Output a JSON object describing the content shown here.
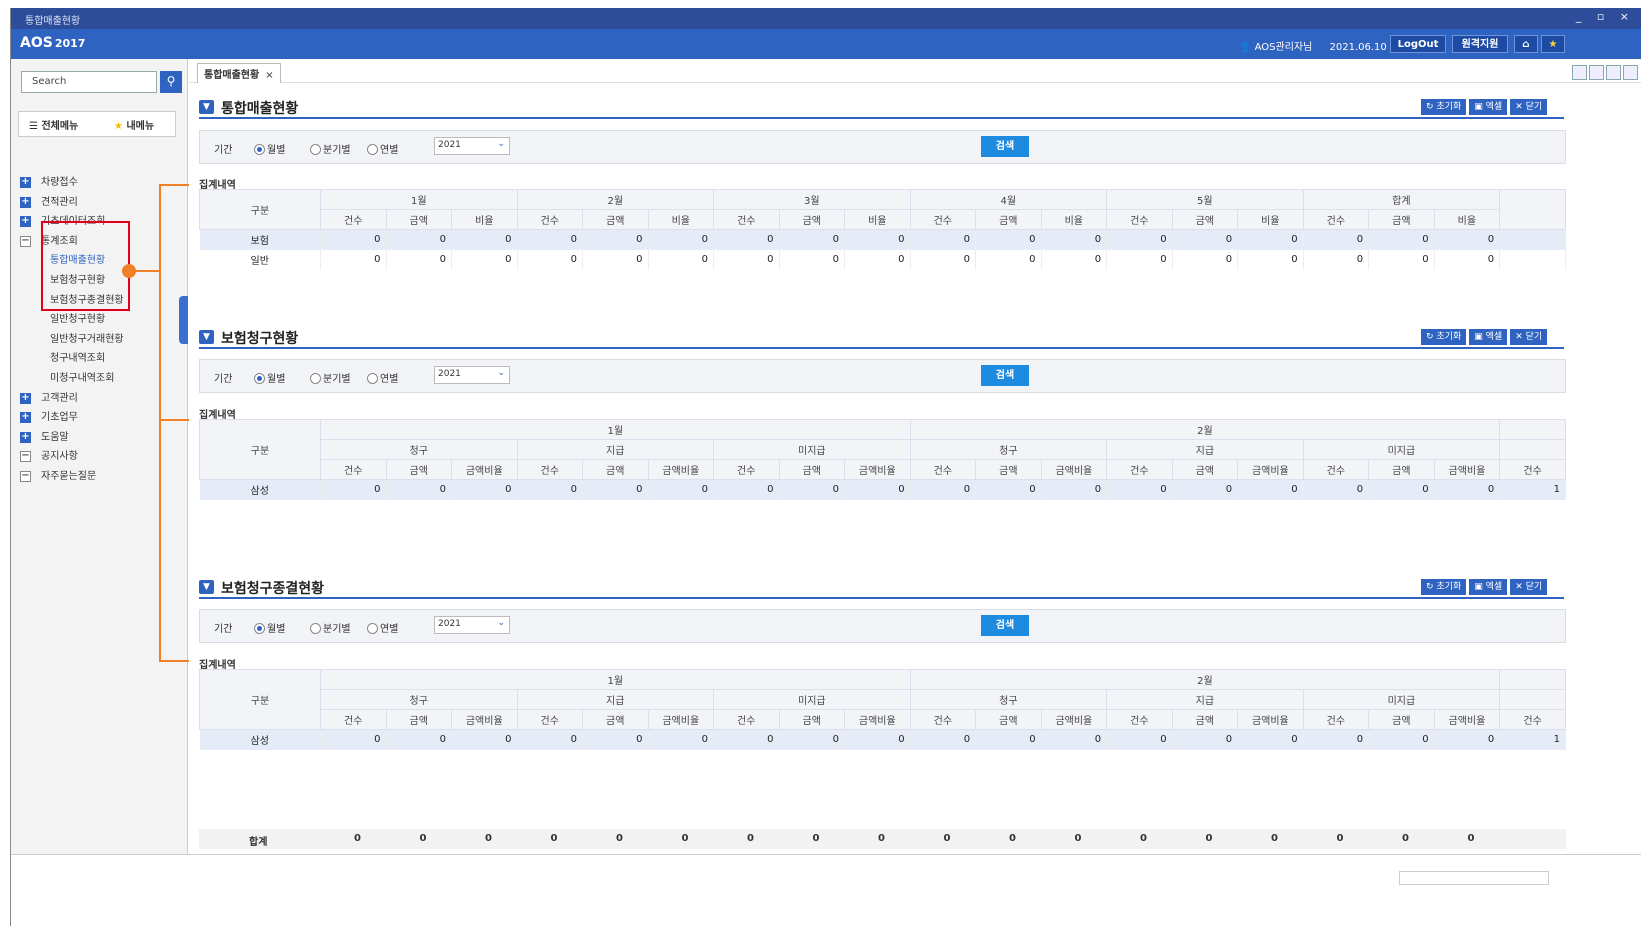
{
  "window": {
    "title": "통합매출현황",
    "controls": "_ ▫ ×"
  },
  "app": {
    "logo": "AOS",
    "year": "2017",
    "user": "AOS관리자님",
    "date": "2021.06.10",
    "logout": "LogOut",
    "remote": "원격지원"
  },
  "sidebar": {
    "search_placeholder": "Search",
    "tab_all": "전체메뉴",
    "tab_my": "내메뉴",
    "items": [
      {
        "label": "차량접수",
        "type": "plus"
      },
      {
        "label": "견적관리",
        "type": "plus"
      },
      {
        "label": "기초데이터조회",
        "type": "plus"
      },
      {
        "label": "통계조회",
        "type": "minus"
      },
      {
        "label": "통합매출현황",
        "type": "sub",
        "active": true
      },
      {
        "label": "보험청구현황",
        "type": "sub"
      },
      {
        "label": "보험청구종결현황",
        "type": "sub"
      },
      {
        "label": "일반청구현황",
        "type": "sub"
      },
      {
        "label": "일반청구거래현황",
        "type": "sub"
      },
      {
        "label": "청구내역조회",
        "type": "sub"
      },
      {
        "label": "미청구내역조회",
        "type": "sub"
      },
      {
        "label": "고객관리",
        "type": "plus"
      },
      {
        "label": "기초업무",
        "type": "plus"
      },
      {
        "label": "도움말",
        "type": "plus"
      },
      {
        "label": "공지사항",
        "type": "minus"
      },
      {
        "label": "자주묻는질문",
        "type": "minus"
      }
    ]
  },
  "tab": {
    "label": "통합매출현황",
    "close": "×"
  },
  "common": {
    "period": "기간",
    "monthly": "월별",
    "quarterly": "분기별",
    "yearly": "연별",
    "year_value": "2021",
    "search": "검색",
    "summary": "집계내역",
    "reset": "초기화",
    "excel": "엑셀",
    "close": "닫기",
    "category": "구분",
    "count": "건수",
    "amount": "금액",
    "ratio": "비율",
    "amount_ratio": "금액비율",
    "claim": "청구",
    "paid": "지급",
    "unpaid": "미지급",
    "total": "합계"
  },
  "section1": {
    "title": "통합매출현황",
    "months": [
      "1월",
      "2월",
      "3월",
      "4월",
      "5월",
      "합계"
    ],
    "rows": [
      {
        "name": "보험",
        "values": [
          "0",
          "0",
          "0",
          "0",
          "0",
          "0",
          "0",
          "0",
          "0",
          "0",
          "0",
          "0",
          "0",
          "0",
          "0",
          "0",
          "0",
          "0"
        ]
      },
      {
        "name": "일반",
        "values": [
          "0",
          "0",
          "0",
          "0",
          "0",
          "0",
          "0",
          "0",
          "0",
          "0",
          "0",
          "0",
          "0",
          "0",
          "0",
          "0",
          "0",
          "0"
        ]
      }
    ]
  },
  "section2": {
    "title": "보험청구현황",
    "months": [
      "1월",
      "2월"
    ],
    "rows": [
      {
        "name": "삼성",
        "values": [
          "0",
          "0",
          "0",
          "0",
          "0",
          "0",
          "0",
          "0",
          "0",
          "0",
          "0",
          "0",
          "0",
          "0",
          "0",
          "0",
          "0",
          "0",
          "1"
        ]
      }
    ]
  },
  "section3": {
    "title": "보험청구종결현황",
    "months": [
      "1월",
      "2월"
    ],
    "rows": [
      {
        "name": "삼성",
        "values": [
          "0",
          "0",
          "0",
          "0",
          "0",
          "0",
          "0",
          "0",
          "0",
          "0",
          "0",
          "0",
          "0",
          "0",
          "0",
          "0",
          "0",
          "0",
          "1"
        ]
      }
    ],
    "total_values": [
      "0",
      "0",
      "0",
      "0",
      "0",
      "0",
      "0",
      "0",
      "0",
      "0",
      "0",
      "0",
      "0",
      "0",
      "0",
      "0",
      "0",
      "0"
    ]
  }
}
